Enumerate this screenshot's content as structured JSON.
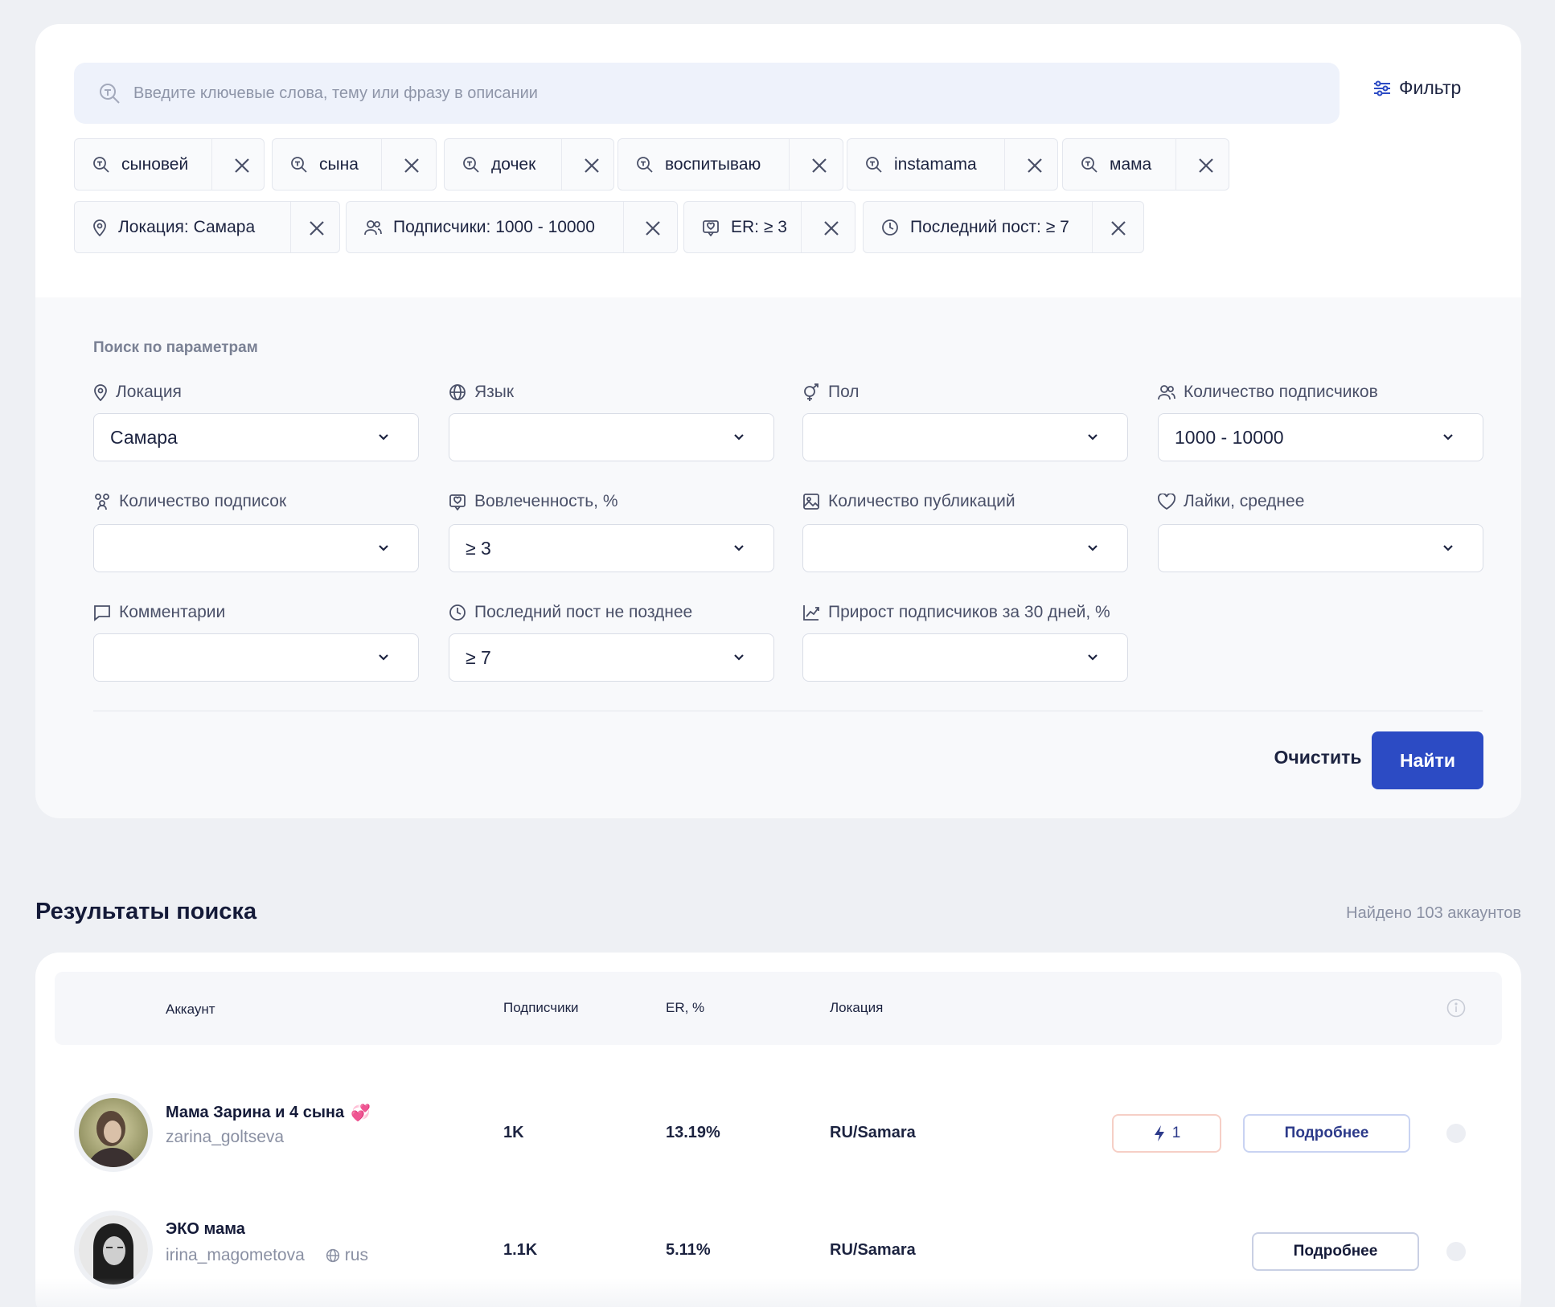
{
  "search": {
    "placeholder": "Введите ключевые слова, тему или фразу в описании",
    "filter_label": "Фильтр"
  },
  "keyword_chips": [
    "сыновей",
    "сына",
    "дочек",
    "воспитываю",
    "instamama",
    "мама"
  ],
  "param_chips": [
    {
      "label": "Локация: Самара",
      "icon": "location-pin-icon"
    },
    {
      "label": "Подписчики: 1000 - 10000",
      "icon": "users-icon"
    },
    {
      "label": "ER: ≥ 3",
      "icon": "engagement-icon"
    },
    {
      "label": "Последний пост: ≥ 7",
      "icon": "clock-icon"
    }
  ],
  "params": {
    "section_title": "Поиск по параметрам",
    "fields": [
      {
        "label": "Локация",
        "value": "Самара",
        "icon": "location-pin-icon"
      },
      {
        "label": "Язык",
        "value": "",
        "icon": "globe-icon"
      },
      {
        "label": "Пол",
        "value": "",
        "icon": "gender-icon"
      },
      {
        "label": "Количество подписчиков",
        "value": "1000 - 10000",
        "icon": "users-icon"
      },
      {
        "label": "Количество подписок",
        "value": "",
        "icon": "following-icon"
      },
      {
        "label": "Вовлеченность, %",
        "value": "≥ 3",
        "icon": "engagement-icon"
      },
      {
        "label": "Количество публикаций",
        "value": "",
        "icon": "image-icon"
      },
      {
        "label": "Лайки, среднее",
        "value": "",
        "icon": "heart-icon"
      },
      {
        "label": "Комментарии",
        "value": "",
        "icon": "comment-icon"
      },
      {
        "label": "Последний пост не позднее",
        "value": "≥ 7",
        "icon": "clock-icon"
      },
      {
        "label": "Прирост подписчиков за 30 дней, %",
        "value": "",
        "icon": "growth-chart-icon"
      }
    ],
    "clear_label": "Очистить",
    "find_label": "Найти"
  },
  "results": {
    "title": "Результаты поиска",
    "count_text": "Найдено 103 аккаунтов",
    "columns": {
      "account": "Аккаунт",
      "followers": "Подписчики",
      "er": "ER, %",
      "location": "Локация"
    },
    "rows": [
      {
        "name": "Мама Зарина и 4 сына",
        "emoji": "💞",
        "username": "zarina_goltseva",
        "lang": "",
        "followers": "1K",
        "er": "13.19%",
        "location": "RU/Samara",
        "badge": "1",
        "more": "Подробнее"
      },
      {
        "name": "ЭКО мама",
        "emoji": "",
        "username": "irina_magometova",
        "lang": "rus",
        "followers": "1.1K",
        "er": "5.11%",
        "location": "RU/Samara",
        "badge": "",
        "more": "Подробнее"
      }
    ]
  },
  "colors": {
    "primary": "#2c4bc4",
    "text": "#1c2340",
    "muted": "#8a90a3",
    "badge_border": "#f6cfc6"
  }
}
